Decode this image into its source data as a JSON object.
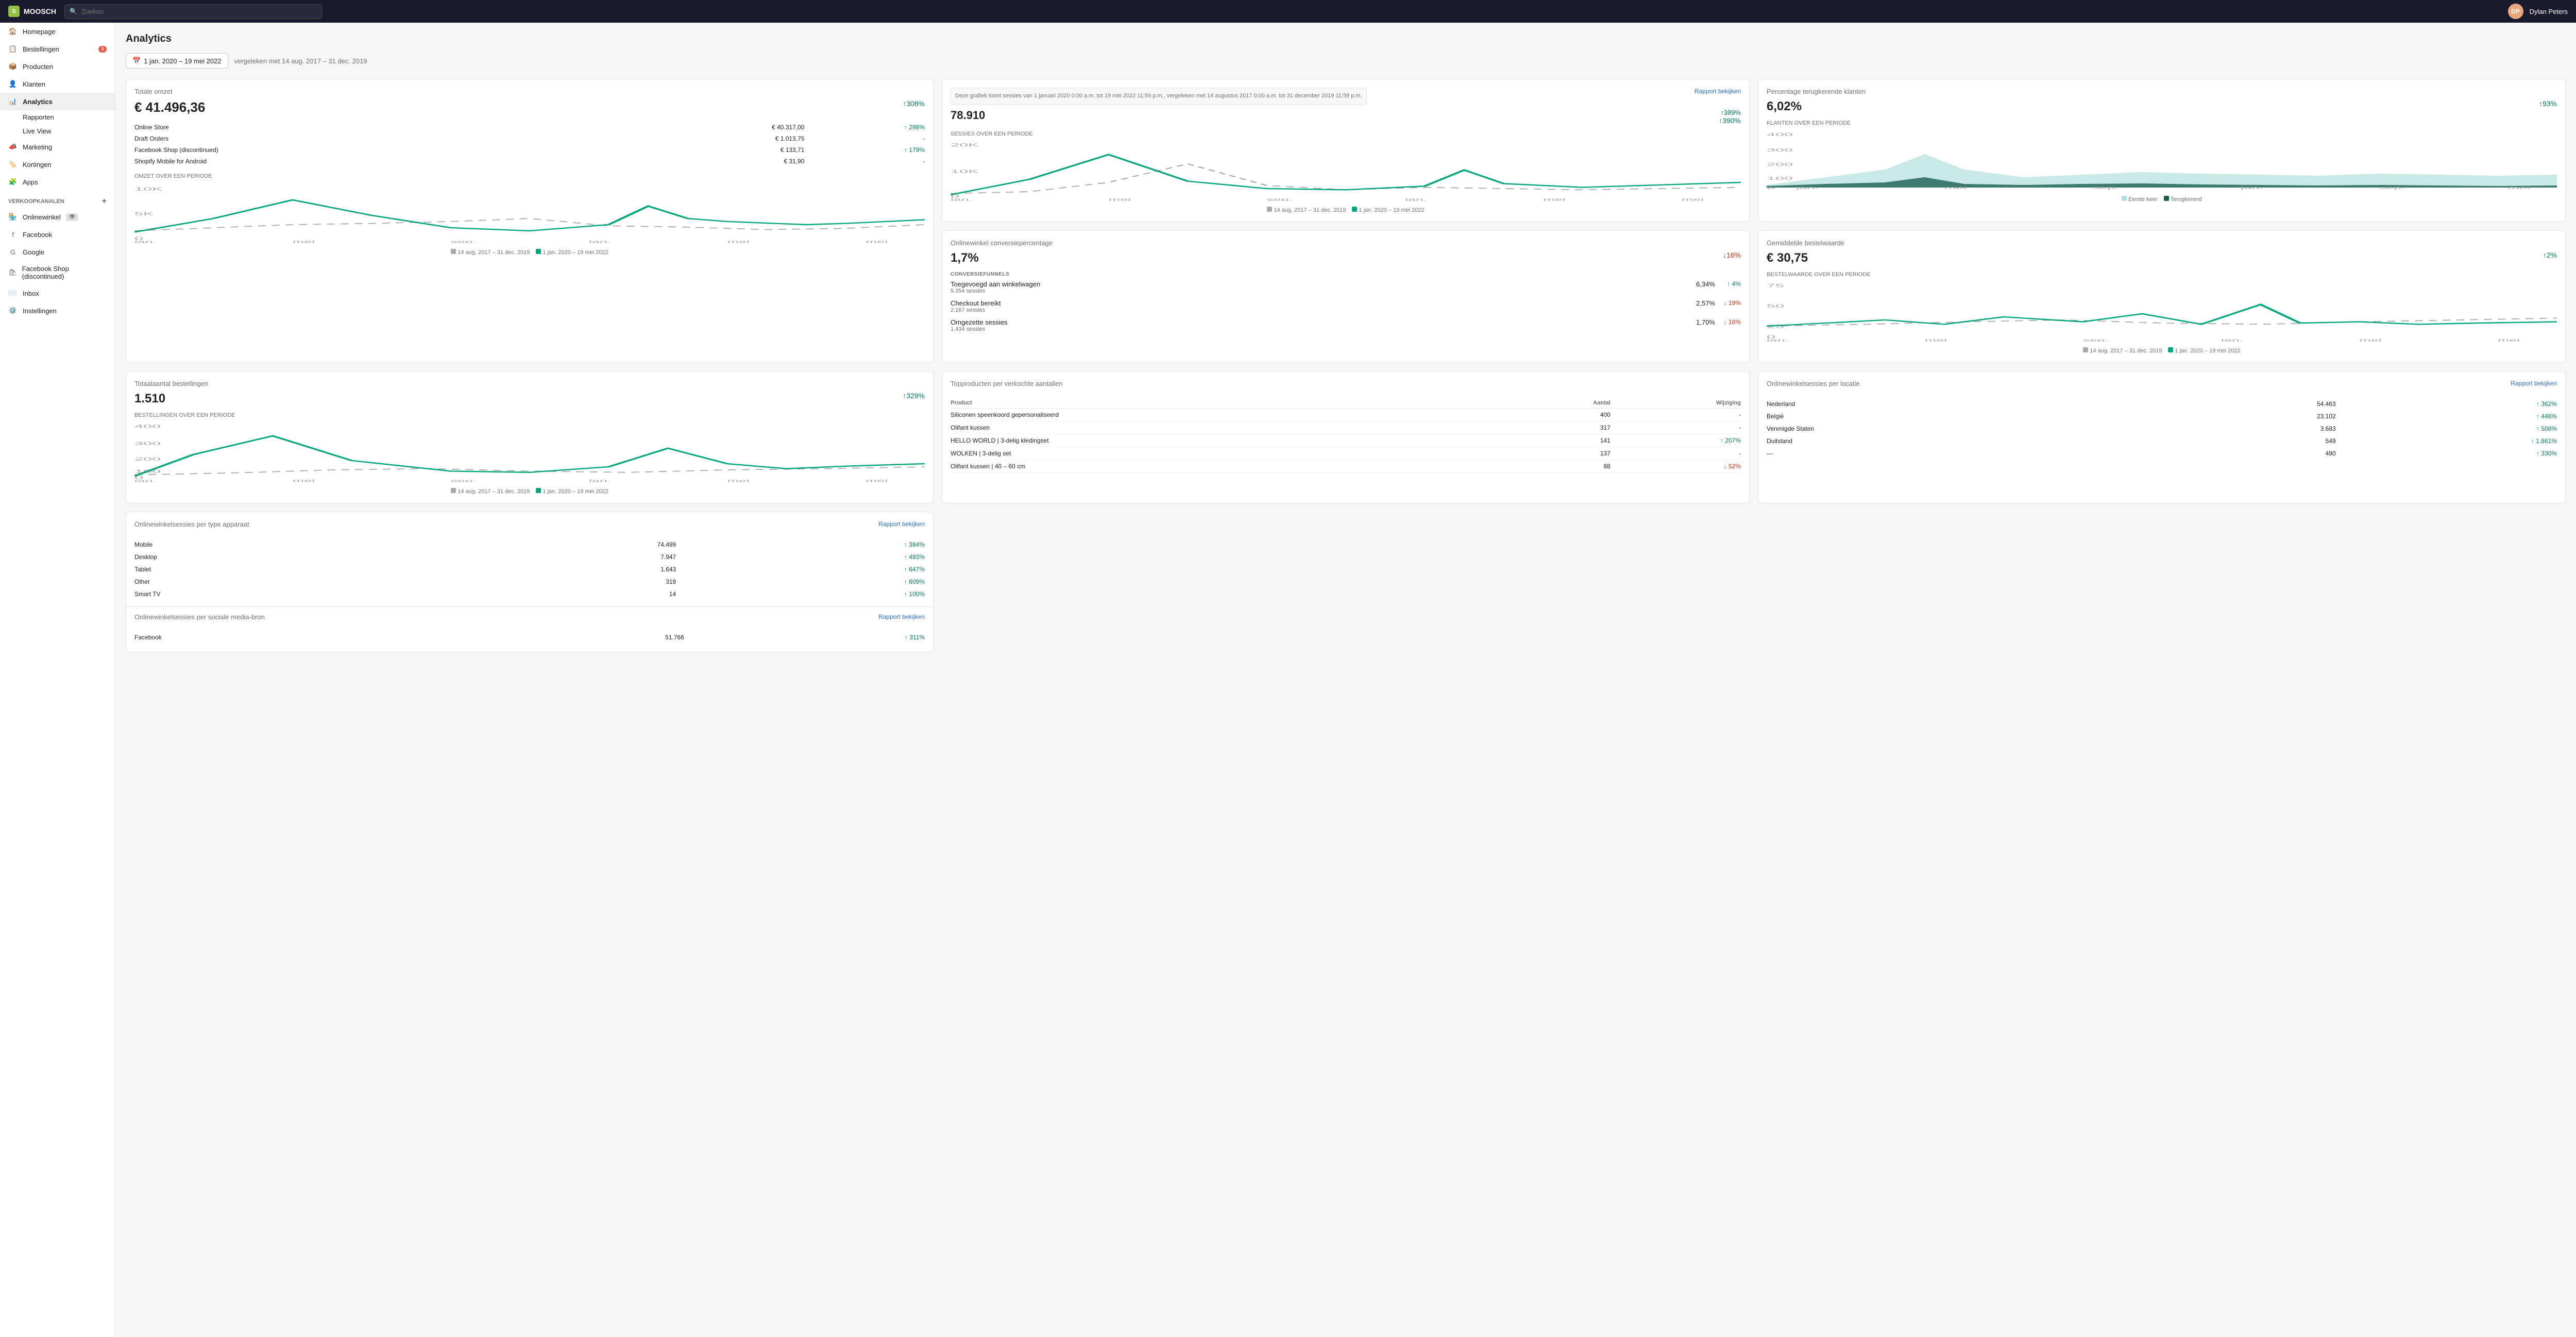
{
  "topbar": {
    "store_name": "MOOSCH",
    "search_placeholder": "Zoeken",
    "user_name": "Dylan Peters",
    "avatar_initials": "DP"
  },
  "sidebar": {
    "items": [
      {
        "id": "homepage",
        "label": "Homepage",
        "icon": "home"
      },
      {
        "id": "bestellingen",
        "label": "Bestellingen",
        "icon": "orders",
        "badge": "5"
      },
      {
        "id": "producten",
        "label": "Producten",
        "icon": "products"
      },
      {
        "id": "klanten",
        "label": "Klanten",
        "icon": "customers"
      },
      {
        "id": "analytics",
        "label": "Analytics",
        "icon": "analytics",
        "active": true
      },
      {
        "id": "rapporten",
        "label": "Rapporten",
        "icon": "",
        "sub": true
      },
      {
        "id": "live-view",
        "label": "Live View",
        "icon": "",
        "sub": true
      },
      {
        "id": "marketing",
        "label": "Marketing",
        "icon": "marketing"
      },
      {
        "id": "kortingen",
        "label": "Kortingen",
        "icon": "discounts"
      },
      {
        "id": "apps",
        "label": "Apps",
        "icon": "apps"
      }
    ],
    "channels_section": "Verkoopkanalen",
    "channels": [
      {
        "id": "onlinewinkel",
        "label": "Onlinewinkel",
        "active": true
      },
      {
        "id": "facebook",
        "label": "Facebook"
      },
      {
        "id": "google",
        "label": "Google"
      },
      {
        "id": "facebook-shop",
        "label": "Facebook Shop (discontinued)"
      }
    ],
    "inbox_label": "Inbox",
    "settings_label": "Instellingen"
  },
  "page": {
    "title": "Analytics",
    "date_range": "1 jan. 2020 – 19 mei 2022",
    "date_compare": "vergeleken met 14 aug. 2017 – 31 dec. 2019"
  },
  "cards": {
    "totale_omzet": {
      "title": "Totale omzet",
      "value": "€ 41.496,36",
      "change": "↑308%",
      "chart_label": "OMZET OVER EEN PERIODE",
      "legend1": "14 aug. 2017 – 31 dec. 2019",
      "legend2": "1 jan. 2020 – 19 mei 2022",
      "rows": [
        {
          "label": "Online Store",
          "value": "€ 40.317,00",
          "change": "↑ 298%"
        },
        {
          "label": "Draft Orders",
          "value": "€ 1.013,75",
          "change": "-"
        },
        {
          "label": "Facebook Shop (discontinued)",
          "value": "€ 133,71",
          "change": "↑ 179%"
        },
        {
          "label": "Shopify Mobile for Android",
          "value": "€ 31,90",
          "change": "-"
        }
      ]
    },
    "sessies": {
      "title": "Deze grafiek toont sessies van 1 januari 2020 0:00 a.m. tot 19 mei 2022 11:59 p.m., vergeleken met 14 augustus 2017 0:00 a.m. tot 31 december 2019 11:59 p.m.",
      "tooltip_visible": true,
      "value": "78.910",
      "change": "↑390%",
      "total_change": "↑389%",
      "chart_label": "SESSIES OVER EEN PERIODE",
      "rapport_link": "Rapport bekijken",
      "legend1": "14 aug. 2017 – 31 dec. 2019",
      "legend2": "1 jan. 2020 – 19 mei 2022"
    },
    "pct_terugkerende": {
      "title": "Percentage terugkerende klanten",
      "value": "6,02%",
      "change": "↑93%",
      "chart_label": "KLANTEN OVER EEN PERIODE",
      "legend1": "Eerste keer",
      "legend2": "Terugkerend"
    },
    "conversie": {
      "title": "Onlinewinkel conversiepercentage",
      "value": "1,7%",
      "change": "↓16%",
      "funnel_title": "CONVERSIEFUNNELS",
      "funnel_rows": [
        {
          "label": "Toegevoegd aan winkelwagen",
          "sub": "5.354 sessies",
          "pct": "6,34%",
          "change": "↑ 4%"
        },
        {
          "label": "Checkout bereikt",
          "sub": "2.167 sessies",
          "pct": "2,57%",
          "change": "↓ 19%"
        },
        {
          "label": "Omgezette sessies",
          "sub": "1.434 sessies",
          "pct": "1,70%",
          "change": "↓ 16%"
        }
      ]
    },
    "gem_bestelwaarde": {
      "title": "Gemiddelde bestelwaarde",
      "value": "€ 30,75",
      "change": "↑2%",
      "chart_label": "BESTELWAARDE OVER EEN PERIODE",
      "legend1": "14 aug. 2017 – 31 dec. 2019",
      "legend2": "1 jan. 2020 – 19 mei 2022"
    },
    "totaal_bestellingen": {
      "title": "Totaalaantal bestellingen",
      "value": "1.510",
      "change": "↑329%",
      "chart_label": "BESTELLINGEN OVER EEN PERIODE",
      "legend1": "14 aug. 2017 – 31 dec. 2019",
      "legend2": "1 jan. 2020 – 19 mei 2022"
    },
    "topproducten": {
      "title": "Topproducten per verkochte aantallen",
      "rows": [
        {
          "label": "Siliconen speenkoord gepersonaliseerd",
          "qty": "400",
          "change": "-"
        },
        {
          "label": "Olifant kussen",
          "qty": "317",
          "change": "-"
        },
        {
          "label": "HELLO WORLD | 3-delig kledingset",
          "qty": "141",
          "change": "↑ 207%"
        },
        {
          "label": "WOLKEN | 3-delig set",
          "qty": "137",
          "change": "-"
        },
        {
          "label": "Olifant kussen | 40 – 60 cm",
          "qty": "88",
          "change": "↓ 52%"
        }
      ]
    },
    "locaties": {
      "title": "Onlinewinkelsessies per locatie",
      "rapport_link": "Rapport bekijken",
      "rows": [
        {
          "label": "Nederland",
          "value": "54.463",
          "change": "↑ 362%"
        },
        {
          "label": "België",
          "value": "23.102",
          "change": "↑ 446%"
        },
        {
          "label": "Verenigde Staten",
          "value": "3.683",
          "change": "↑ 508%"
        },
        {
          "label": "Duitsland",
          "value": "549",
          "change": "↑ 1.861%"
        },
        {
          "label": "—",
          "value": "490",
          "change": "↑ 330%"
        }
      ]
    },
    "devices": {
      "title": "Onlinewinkelsessies per type apparaat",
      "rapport_link": "Rapport bekijken",
      "rows": [
        {
          "label": "Mobile",
          "value": "74.499",
          "change": "↑ 384%"
        },
        {
          "label": "Desktop",
          "value": "7.947",
          "change": "↑ 493%"
        },
        {
          "label": "Tablet",
          "value": "1.643",
          "change": "↑ 647%"
        },
        {
          "label": "Other",
          "value": "319",
          "change": "↑ 609%"
        },
        {
          "label": "Smart TV",
          "value": "14",
          "change": "↑ 100%"
        }
      ]
    },
    "sociale_media": {
      "title": "Onlinewinkelsessies per sociale media-bron",
      "rapport_link": "Rapport bekijken",
      "rows": [
        {
          "label": "Facebook",
          "value": "51.766",
          "change": "↑ 311%"
        }
      ]
    }
  }
}
